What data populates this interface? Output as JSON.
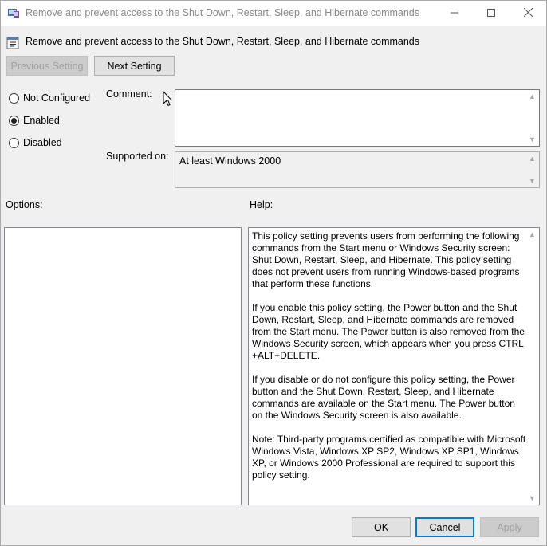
{
  "window": {
    "title": "Remove and prevent access to the Shut Down, Restart, Sleep, and Hibernate commands",
    "minimize_icon": "minimize-icon",
    "maximize_icon": "maximize-icon",
    "close_icon": "close-icon"
  },
  "policy": {
    "title": "Remove and prevent access to the Shut Down, Restart, Sleep, and Hibernate commands"
  },
  "nav": {
    "previous_label": "Previous Setting",
    "next_label": "Next Setting"
  },
  "state": {
    "options": [
      {
        "label": "Not Configured",
        "checked": false
      },
      {
        "label": "Enabled",
        "checked": true
      },
      {
        "label": "Disabled",
        "checked": false
      }
    ]
  },
  "comment": {
    "label": "Comment:",
    "value": ""
  },
  "supported": {
    "label": "Supported on:",
    "value": "At least Windows 2000"
  },
  "options_panel": {
    "label": "Options:"
  },
  "help_panel": {
    "label": "Help:",
    "text": "This policy setting prevents users from performing the following commands from the Start menu or Windows Security screen: Shut Down, Restart, Sleep, and Hibernate. This policy setting does not prevent users from running Windows-based programs that perform these functions.\n\nIf you enable this policy setting, the Power button and the Shut Down, Restart, Sleep, and Hibernate commands are removed from the Start menu. The Power button is also removed from the Windows Security screen, which appears when you press CTRL +ALT+DELETE.\n\nIf you disable or do not configure this policy setting, the Power button and the Shut Down, Restart, Sleep, and Hibernate commands are available on the Start menu. The Power button on the Windows Security screen is also available.\n\nNote: Third-party programs certified as compatible with Microsoft Windows Vista, Windows XP SP2, Windows XP SP1, Windows XP, or Windows 2000 Professional are required to support this policy setting."
  },
  "footer": {
    "ok_label": "OK",
    "cancel_label": "Cancel",
    "apply_label": "Apply"
  },
  "colors": {
    "accent": "#0078d7",
    "disabled_text": "#a0a0a0",
    "window_bg": "#f0f0f0"
  }
}
